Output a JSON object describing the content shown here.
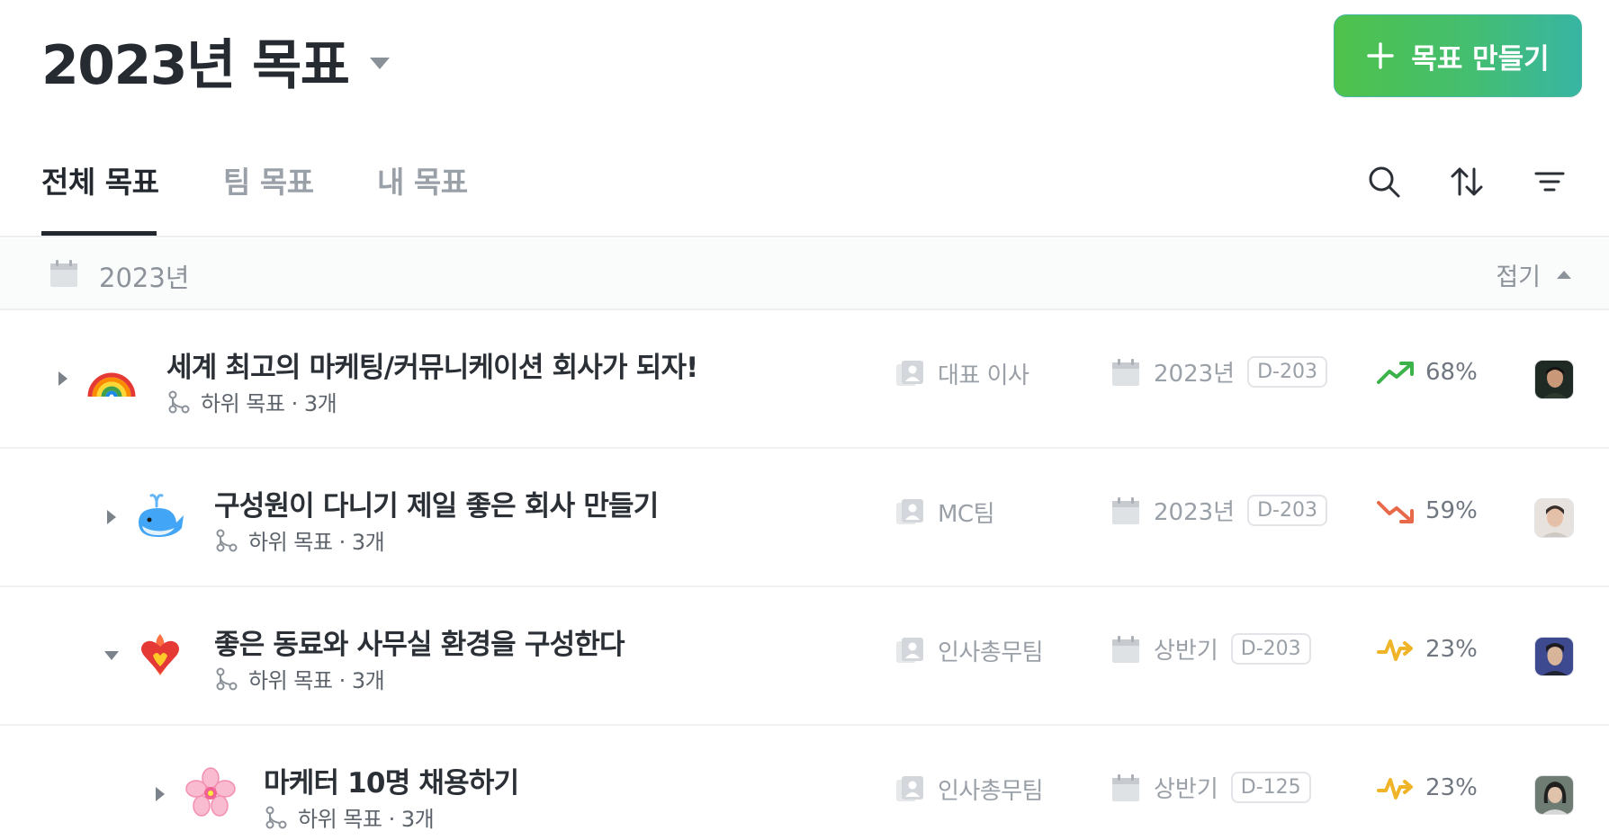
{
  "header": {
    "title": "2023년 목표",
    "create_button": "목표 만들기"
  },
  "tabs": [
    {
      "label": "전체 목표",
      "active": true
    },
    {
      "label": "팀 목표",
      "active": false
    },
    {
      "label": "내 목표",
      "active": false
    }
  ],
  "toolbar": {
    "icons": [
      "search-icon",
      "sort-icon",
      "filter-icon"
    ]
  },
  "group": {
    "label": "2023년",
    "collapse_label": "접기"
  },
  "goals": [
    {
      "title": "세계 최고의 마케팅/커뮤니케이션 회사가 되자!",
      "sub": "하위 목표 · 3개",
      "team": "대표 이사",
      "period": "2023년",
      "dday": "D-203",
      "progress": "68%",
      "trend": "up",
      "trend_color": "#3cb24a",
      "emoji": "rainbow-icon",
      "expanded": false
    },
    {
      "title": "구성원이 다니기 제일 좋은 회사 만들기",
      "sub": "하위 목표 · 3개",
      "team": "MC팀",
      "period": "2023년",
      "dday": "D-203",
      "progress": "59%",
      "trend": "down",
      "trend_color": "#e8694a",
      "emoji": "whale-icon",
      "expanded": false
    },
    {
      "title": "좋은 동료와 사무실 환경을 구성한다",
      "sub": "하위 목표 · 3개",
      "team": "인사총무팀",
      "period": "상반기",
      "dday": "D-203",
      "progress": "23%",
      "trend": "flat",
      "trend_color": "#f0b429",
      "emoji": "heart-on-fire-icon",
      "expanded": true
    },
    {
      "title": "마케터 10명 채용하기",
      "sub": "하위 목표 · 3개",
      "team": "인사총무팀",
      "period": "상반기",
      "dday": "D-125",
      "progress": "23%",
      "trend": "flat",
      "trend_color": "#f0b429",
      "emoji": "cherry-blossom-icon",
      "expanded": false
    }
  ]
}
